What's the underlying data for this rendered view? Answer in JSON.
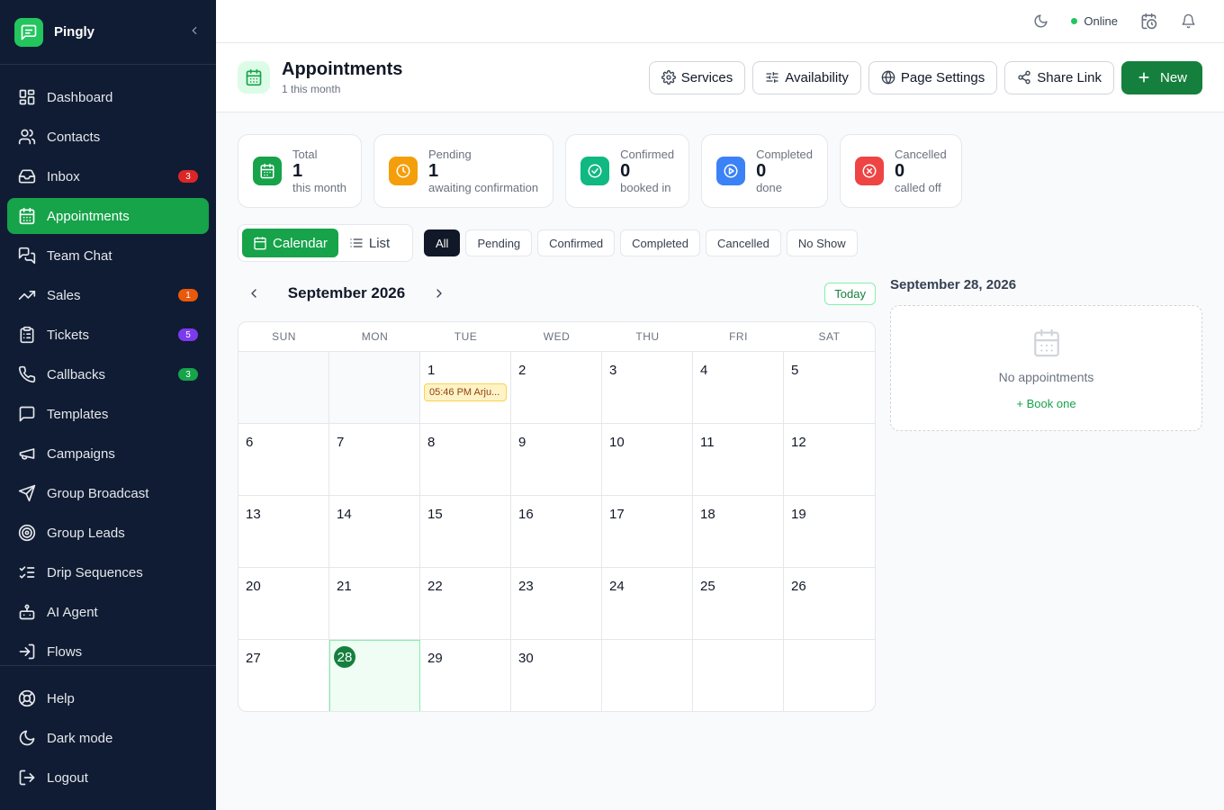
{
  "brand": {
    "name": "Pingly"
  },
  "sidebar": {
    "items": [
      {
        "key": "dashboard",
        "label": "Dashboard",
        "icon": "dashboard-icon"
      },
      {
        "key": "contacts",
        "label": "Contacts",
        "icon": "contacts-icon"
      },
      {
        "key": "inbox",
        "label": "Inbox",
        "icon": "inbox-icon",
        "badge": "3",
        "badge_color": "#dc2626"
      },
      {
        "key": "appointments",
        "label": "Appointments",
        "icon": "calendar-icon",
        "active": true
      },
      {
        "key": "team-chat",
        "label": "Team Chat",
        "icon": "chat-icon"
      },
      {
        "key": "sales",
        "label": "Sales",
        "icon": "trend-icon",
        "badge": "1",
        "badge_color": "#ea580c"
      },
      {
        "key": "tickets",
        "label": "Tickets",
        "icon": "clipboard-icon",
        "badge": "5",
        "badge_color": "#7c3aed"
      },
      {
        "key": "callbacks",
        "label": "Callbacks",
        "icon": "phone-icon",
        "badge": "3",
        "badge_color": "#16a34a"
      },
      {
        "key": "templates",
        "label": "Templates",
        "icon": "message-square-icon"
      },
      {
        "key": "campaigns",
        "label": "Campaigns",
        "icon": "megaphone-icon"
      },
      {
        "key": "group-broadcast",
        "label": "Group Broadcast",
        "icon": "send-icon"
      },
      {
        "key": "group-leads",
        "label": "Group Leads",
        "icon": "target-icon"
      },
      {
        "key": "drip-sequences",
        "label": "Drip Sequences",
        "icon": "list-checks-icon"
      },
      {
        "key": "ai-agent",
        "label": "AI Agent",
        "icon": "bot-icon"
      },
      {
        "key": "flows",
        "label": "Flows",
        "icon": "flow-icon"
      }
    ],
    "bottom": [
      {
        "key": "help",
        "label": "Help",
        "icon": "lifebuoy-icon"
      },
      {
        "key": "dark-mode",
        "label": "Dark mode",
        "icon": "moon-icon"
      },
      {
        "key": "logout",
        "label": "Logout",
        "icon": "logout-icon"
      }
    ]
  },
  "topbar": {
    "status": "Online"
  },
  "header": {
    "title": "Appointments",
    "subtitle": "1 this month",
    "buttons": {
      "services": "Services",
      "availability": "Availability",
      "page_settings": "Page Settings",
      "share_link": "Share Link",
      "new": "New"
    }
  },
  "stats": [
    {
      "key": "total",
      "label": "Total",
      "value": "1",
      "sub": "this month",
      "color": "#16a34a"
    },
    {
      "key": "pending",
      "label": "Pending",
      "value": "1",
      "sub": "awaiting confirmation",
      "color": "#f59e0b"
    },
    {
      "key": "confirmed",
      "label": "Confirmed",
      "value": "0",
      "sub": "booked in",
      "color": "#10b981"
    },
    {
      "key": "completed",
      "label": "Completed",
      "value": "0",
      "sub": "done",
      "color": "#3b82f6"
    },
    {
      "key": "cancelled",
      "label": "Cancelled",
      "value": "0",
      "sub": "called off",
      "color": "#ef4444"
    }
  ],
  "views": {
    "calendar": "Calendar",
    "list": "List"
  },
  "filters": [
    "All",
    "Pending",
    "Confirmed",
    "Completed",
    "Cancelled",
    "No Show"
  ],
  "calendar": {
    "month_label": "September 2026",
    "today_label": "Today",
    "weekdays": [
      "SUN",
      "MON",
      "TUE",
      "WED",
      "THU",
      "FRI",
      "SAT"
    ],
    "leading_blanks": 2,
    "days_in_month": 30,
    "selected_day": 28,
    "appointments": [
      {
        "day": 1,
        "label": "05:46 PM Arju..."
      }
    ]
  },
  "side_panel": {
    "date": "September 28, 2026",
    "empty": "No appointments",
    "book": "+ Book one"
  }
}
